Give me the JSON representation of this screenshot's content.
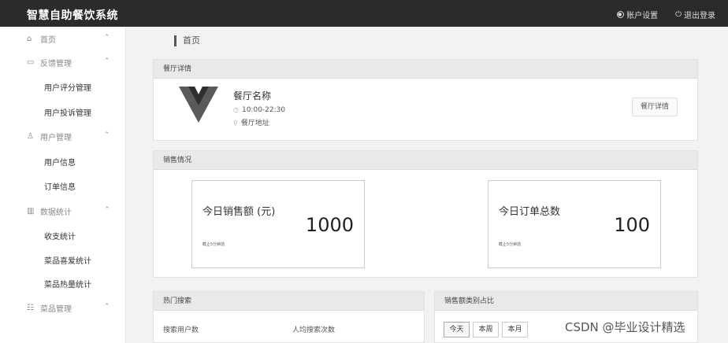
{
  "app": {
    "title": "智慧自助餐饮系统"
  },
  "header": {
    "account_settings": "账户设置",
    "logout": "退出登录"
  },
  "sidebar": {
    "items": [
      {
        "type": "group",
        "label": "首页",
        "icon": "home-icon"
      },
      {
        "type": "group",
        "label": "反馈管理",
        "icon": "feedback-icon"
      },
      {
        "type": "sub",
        "label": "用户评分管理"
      },
      {
        "type": "sub",
        "label": "用户投诉管理"
      },
      {
        "type": "group",
        "label": "用户管理",
        "icon": "user-icon"
      },
      {
        "type": "sub",
        "label": "用户信息"
      },
      {
        "type": "sub",
        "label": "订单信息"
      },
      {
        "type": "group",
        "label": "数据统计",
        "icon": "chart-icon"
      },
      {
        "type": "sub",
        "label": "收支统计"
      },
      {
        "type": "sub",
        "label": "菜品喜爱统计"
      },
      {
        "type": "sub",
        "label": "菜品热量统计"
      },
      {
        "type": "group",
        "label": "菜品管理",
        "icon": "dish-icon"
      }
    ]
  },
  "breadcrumb": {
    "current": "首页"
  },
  "restaurant": {
    "panel_title": "餐厅详情",
    "name": "餐厅名称",
    "hours": "10:00-22:30",
    "address": "餐厅地址",
    "detail_button": "餐厅详情"
  },
  "sales": {
    "panel_title": "销售情况",
    "today_sales_title": "今日销售额 (元)",
    "today_sales_value": "1000",
    "today_sales_note": "截止5分钟前",
    "today_orders_title": "今日订单总数",
    "today_orders_value": "100",
    "today_orders_note": "截止5分钟前"
  },
  "hot_search": {
    "panel_title": "热门搜索",
    "col_users": "搜索用户数",
    "col_avg": "人均搜索次数"
  },
  "category": {
    "panel_title": "销售额类别占比",
    "tabs": [
      "今天",
      "本周",
      "本月"
    ],
    "active_tab": "今天"
  },
  "watermark": "CSDN @毕业设计精选"
}
